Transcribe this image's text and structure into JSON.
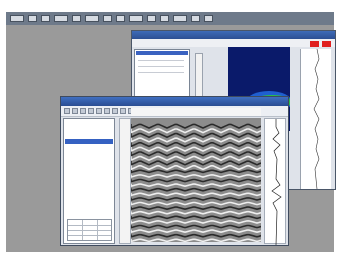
{
  "os_taskbar": {
    "button_count": 14
  },
  "back_window": {
    "title": "",
    "menu_items": [
      "",
      "",
      "",
      "",
      ""
    ],
    "colors": {
      "plot_bg": "#0a1a6a",
      "hot": "#2bbf4a",
      "core": "#f0f0f0",
      "stop": "#e02020"
    }
  },
  "front_window": {
    "title": "",
    "toolbar_button_count": 20,
    "file_list": [
      {
        "name": "",
        "value": "",
        "selected": false
      },
      {
        "name": "",
        "value": "",
        "selected": false
      },
      {
        "name": "",
        "value": "",
        "selected": false
      },
      {
        "name": "",
        "value": "",
        "selected": true
      }
    ],
    "radargram": {
      "style": "grayscale hyperbolic reflections"
    }
  }
}
